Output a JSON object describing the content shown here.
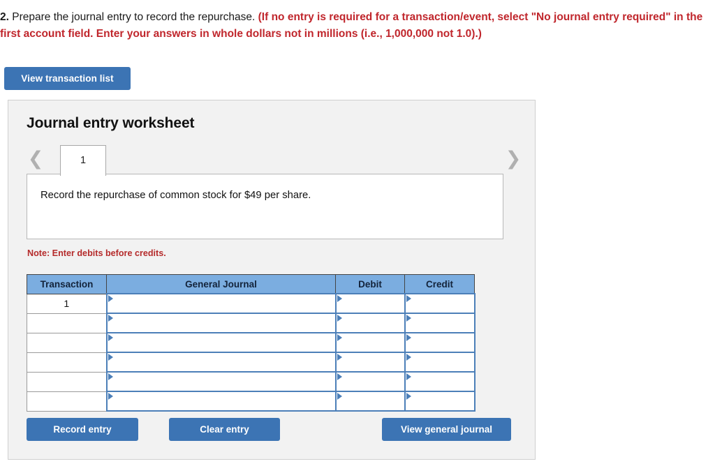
{
  "question": {
    "number": "2.",
    "text": " Prepare the journal entry to record the repurchase. ",
    "instruction": "(If no entry is required for a transaction/event, select \"No journal entry required\" in the first account field. Enter your answers in whole dollars not in millions (i.e., 1,000,000 not 1.0).)"
  },
  "toolbar": {
    "view_transaction_list_label": "View transaction list"
  },
  "worksheet": {
    "title": "Journal entry worksheet",
    "tabs": [
      {
        "label": "1",
        "active": true
      }
    ],
    "prev_arrow_icon": "chevron-left-icon",
    "next_arrow_icon": "chevron-right-icon",
    "scenario_text": "Record the repurchase of common stock for $49 per share.",
    "note": "Note: Enter debits before credits."
  },
  "table": {
    "columns": [
      "Transaction",
      "General Journal",
      "Debit",
      "Credit"
    ],
    "rows": [
      {
        "transaction": "1",
        "general_journal": "",
        "debit": "",
        "credit": ""
      },
      {
        "transaction": "",
        "general_journal": "",
        "debit": "",
        "credit": ""
      },
      {
        "transaction": "",
        "general_journal": "",
        "debit": "",
        "credit": ""
      },
      {
        "transaction": "",
        "general_journal": "",
        "debit": "",
        "credit": ""
      },
      {
        "transaction": "",
        "general_journal": "",
        "debit": "",
        "credit": ""
      },
      {
        "transaction": "",
        "general_journal": "",
        "debit": "",
        "credit": ""
      }
    ]
  },
  "actions": {
    "record_entry_label": "Record entry",
    "clear_entry_label": "Clear entry",
    "view_general_journal_label": "View general journal"
  },
  "colors": {
    "button_blue": "#3c74b4",
    "header_blue": "#7badE0",
    "input_border_blue": "#4c7fb8",
    "note_red": "#b52b2b",
    "instruction_red": "#c0262c",
    "panel_gray": "#f2f2f2"
  }
}
